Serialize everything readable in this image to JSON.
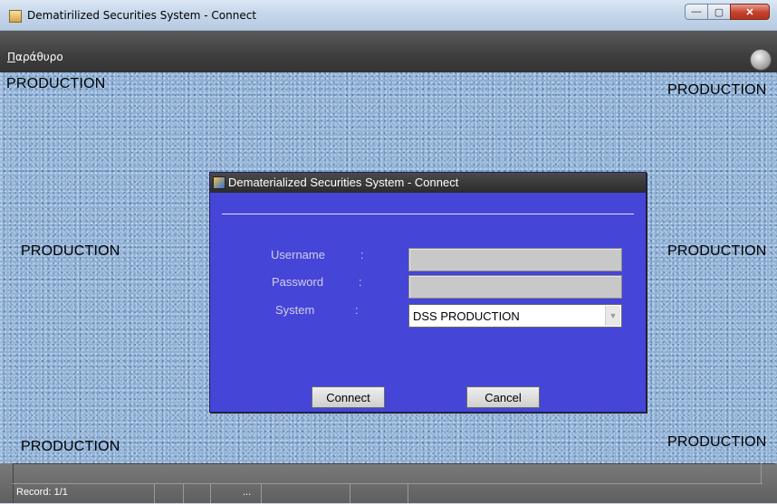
{
  "window": {
    "title": "Dematirilized Securities System - Connect",
    "buttons": {
      "minimize": "—",
      "maximize": "▢",
      "close": "✕"
    }
  },
  "menubar": {
    "menu_first": "Π",
    "menu_rest": "αράθυρο"
  },
  "canvas": {
    "watermark": "PRODUCTION"
  },
  "dialog": {
    "title": "Dematerialized Securities System - Connect",
    "username_label": "Username",
    "password_label": "Password",
    "system_label": "System",
    "colon": ":",
    "username_value": "",
    "password_value": "",
    "system_value": "DSS PRODUCTION",
    "connect_label": "Connect",
    "cancel_label": "Cancel"
  },
  "statusbar": {
    "record": "Record: 1/1",
    "ellipsis": "..."
  },
  "colors": {
    "dialog_bg": "#4545d8",
    "canvas_bg": "#8fb1d6"
  }
}
